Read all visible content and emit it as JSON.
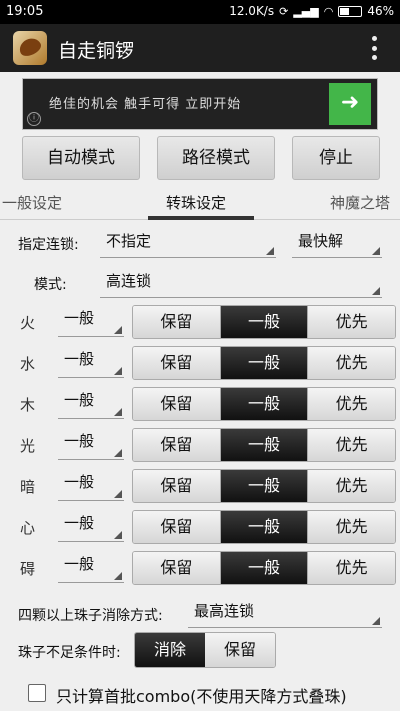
{
  "status_bar": {
    "time": "19:05",
    "network_speed": "12.0K/s",
    "battery_percent": "46%",
    "battery_level": 0.46
  },
  "app": {
    "title": "自走铜锣",
    "icon": "app-leaf-icon"
  },
  "ad": {
    "text": "绝佳的机会 触手可得   立即开始",
    "info_icon": "ⓘ",
    "go_icon": "➜"
  },
  "mode_buttons": {
    "auto": "自动模式",
    "path": "路径模式",
    "stop": "停止"
  },
  "tabs": [
    {
      "label": "一般设定"
    },
    {
      "label": "转珠设定"
    },
    {
      "label": "神魔之塔"
    }
  ],
  "combo": {
    "label": "指定连锁:",
    "value": "不指定",
    "solve_value": "最快解"
  },
  "mode": {
    "label": "模式:",
    "value": "高连锁"
  },
  "elements": [
    {
      "name": "火",
      "spinner": "一般"
    },
    {
      "name": "水",
      "spinner": "一般"
    },
    {
      "name": "木",
      "spinner": "一般"
    },
    {
      "name": "光",
      "spinner": "一般"
    },
    {
      "name": "暗",
      "spinner": "一般"
    },
    {
      "name": "心",
      "spinner": "一般"
    },
    {
      "name": "碍",
      "spinner": "一般"
    }
  ],
  "segment_options": [
    "保留",
    "一般",
    "优先"
  ],
  "segment_selected": "一般",
  "four_beads": {
    "label": "四颗以上珠子消除方式:",
    "value": "最高连锁"
  },
  "insufficient": {
    "label": "珠子不足条件时:",
    "options": [
      "消除",
      "保留"
    ],
    "selected": "消除"
  },
  "checkbox": {
    "label": "只计算首批combo(不使用天降方式叠珠)",
    "checked": false
  }
}
